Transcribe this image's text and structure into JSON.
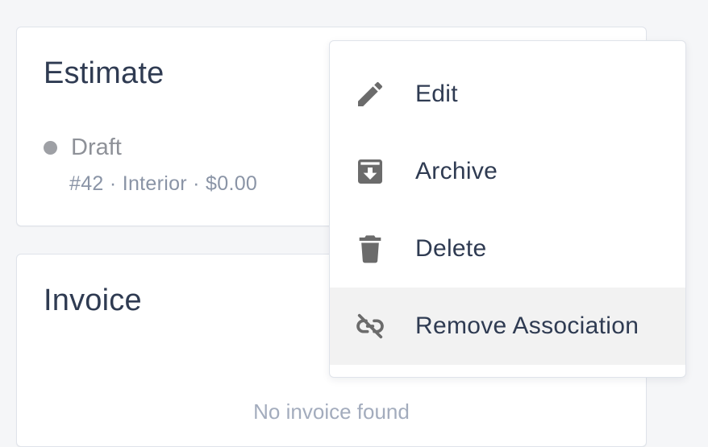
{
  "estimate": {
    "title": "Estimate",
    "status": "Draft",
    "meta": "#42 · Interior · $0.00"
  },
  "invoice": {
    "title": "Invoice",
    "empty_text": "No invoice found"
  },
  "menu": {
    "items": [
      {
        "label": "Edit",
        "icon": "pencil-icon"
      },
      {
        "label": "Archive",
        "icon": "archive-icon"
      },
      {
        "label": "Delete",
        "icon": "trash-icon"
      },
      {
        "label": "Remove Association",
        "icon": "unlink-icon"
      }
    ],
    "highlighted": "Remove Association"
  },
  "colors": {
    "background": "#f5f6f8",
    "text": "#2f3b52",
    "muted": "#8a94a6",
    "icon": "#6b6b6b",
    "highlight": "#f2f2f2"
  }
}
